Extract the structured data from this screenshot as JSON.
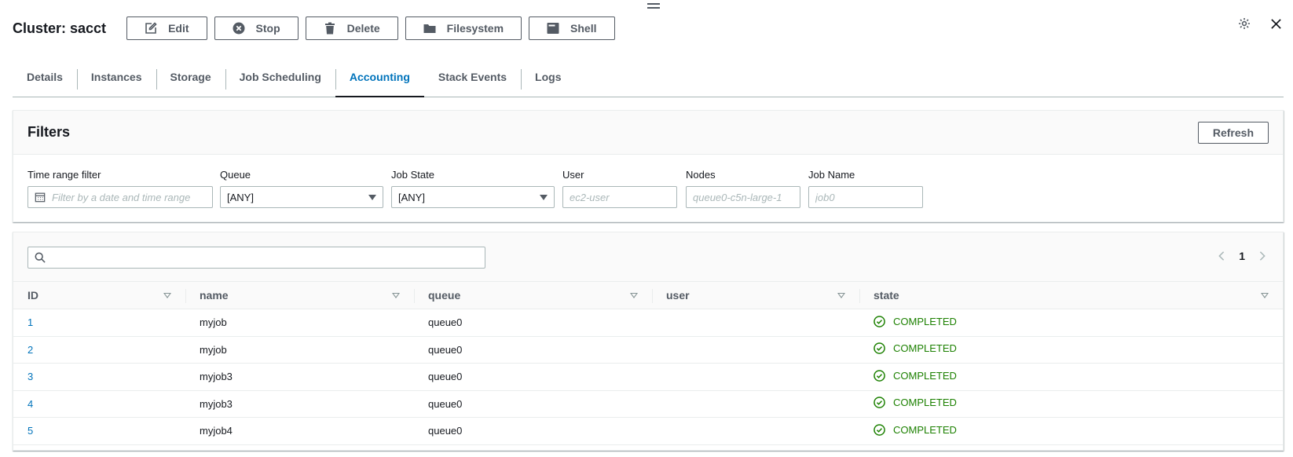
{
  "header": {
    "title": "Cluster: sacct",
    "buttons": [
      {
        "label": "Edit",
        "icon": "edit-icon"
      },
      {
        "label": "Stop",
        "icon": "stop-icon"
      },
      {
        "label": "Delete",
        "icon": "trash-icon"
      },
      {
        "label": "Filesystem",
        "icon": "folder-icon"
      },
      {
        "label": "Shell",
        "icon": "terminal-icon"
      }
    ]
  },
  "tabs": [
    "Details",
    "Instances",
    "Storage",
    "Job Scheduling",
    "Accounting",
    "Stack Events",
    "Logs"
  ],
  "active_tab": "Accounting",
  "filters": {
    "title": "Filters",
    "refresh_label": "Refresh",
    "time_range": {
      "label": "Time range filter",
      "placeholder": "Filter by a date and time range"
    },
    "queue": {
      "label": "Queue",
      "value": "[ANY]"
    },
    "job_state": {
      "label": "Job State",
      "value": "[ANY]"
    },
    "user": {
      "label": "User",
      "placeholder": "ec2-user"
    },
    "nodes": {
      "label": "Nodes",
      "placeholder": "queue0-c5n-large-1"
    },
    "job_name": {
      "label": "Job Name",
      "placeholder": "job0"
    }
  },
  "table": {
    "search_value": "",
    "page": "1",
    "columns": [
      "ID",
      "name",
      "queue",
      "user",
      "state"
    ],
    "rows": [
      {
        "id": "1",
        "name": "myjob",
        "queue": "queue0",
        "user": "",
        "state": "COMPLETED"
      },
      {
        "id": "2",
        "name": "myjob",
        "queue": "queue0",
        "user": "",
        "state": "COMPLETED"
      },
      {
        "id": "3",
        "name": "myjob3",
        "queue": "queue0",
        "user": "",
        "state": "COMPLETED"
      },
      {
        "id": "4",
        "name": "myjob3",
        "queue": "queue0",
        "user": "",
        "state": "COMPLETED"
      },
      {
        "id": "5",
        "name": "myjob4",
        "queue": "queue0",
        "user": "",
        "state": "COMPLETED"
      }
    ]
  },
  "colors": {
    "accent": "#0073bb",
    "success": "#1d8102",
    "text": "#16191f",
    "muted": "#545b64",
    "border": "#aab7b8"
  }
}
